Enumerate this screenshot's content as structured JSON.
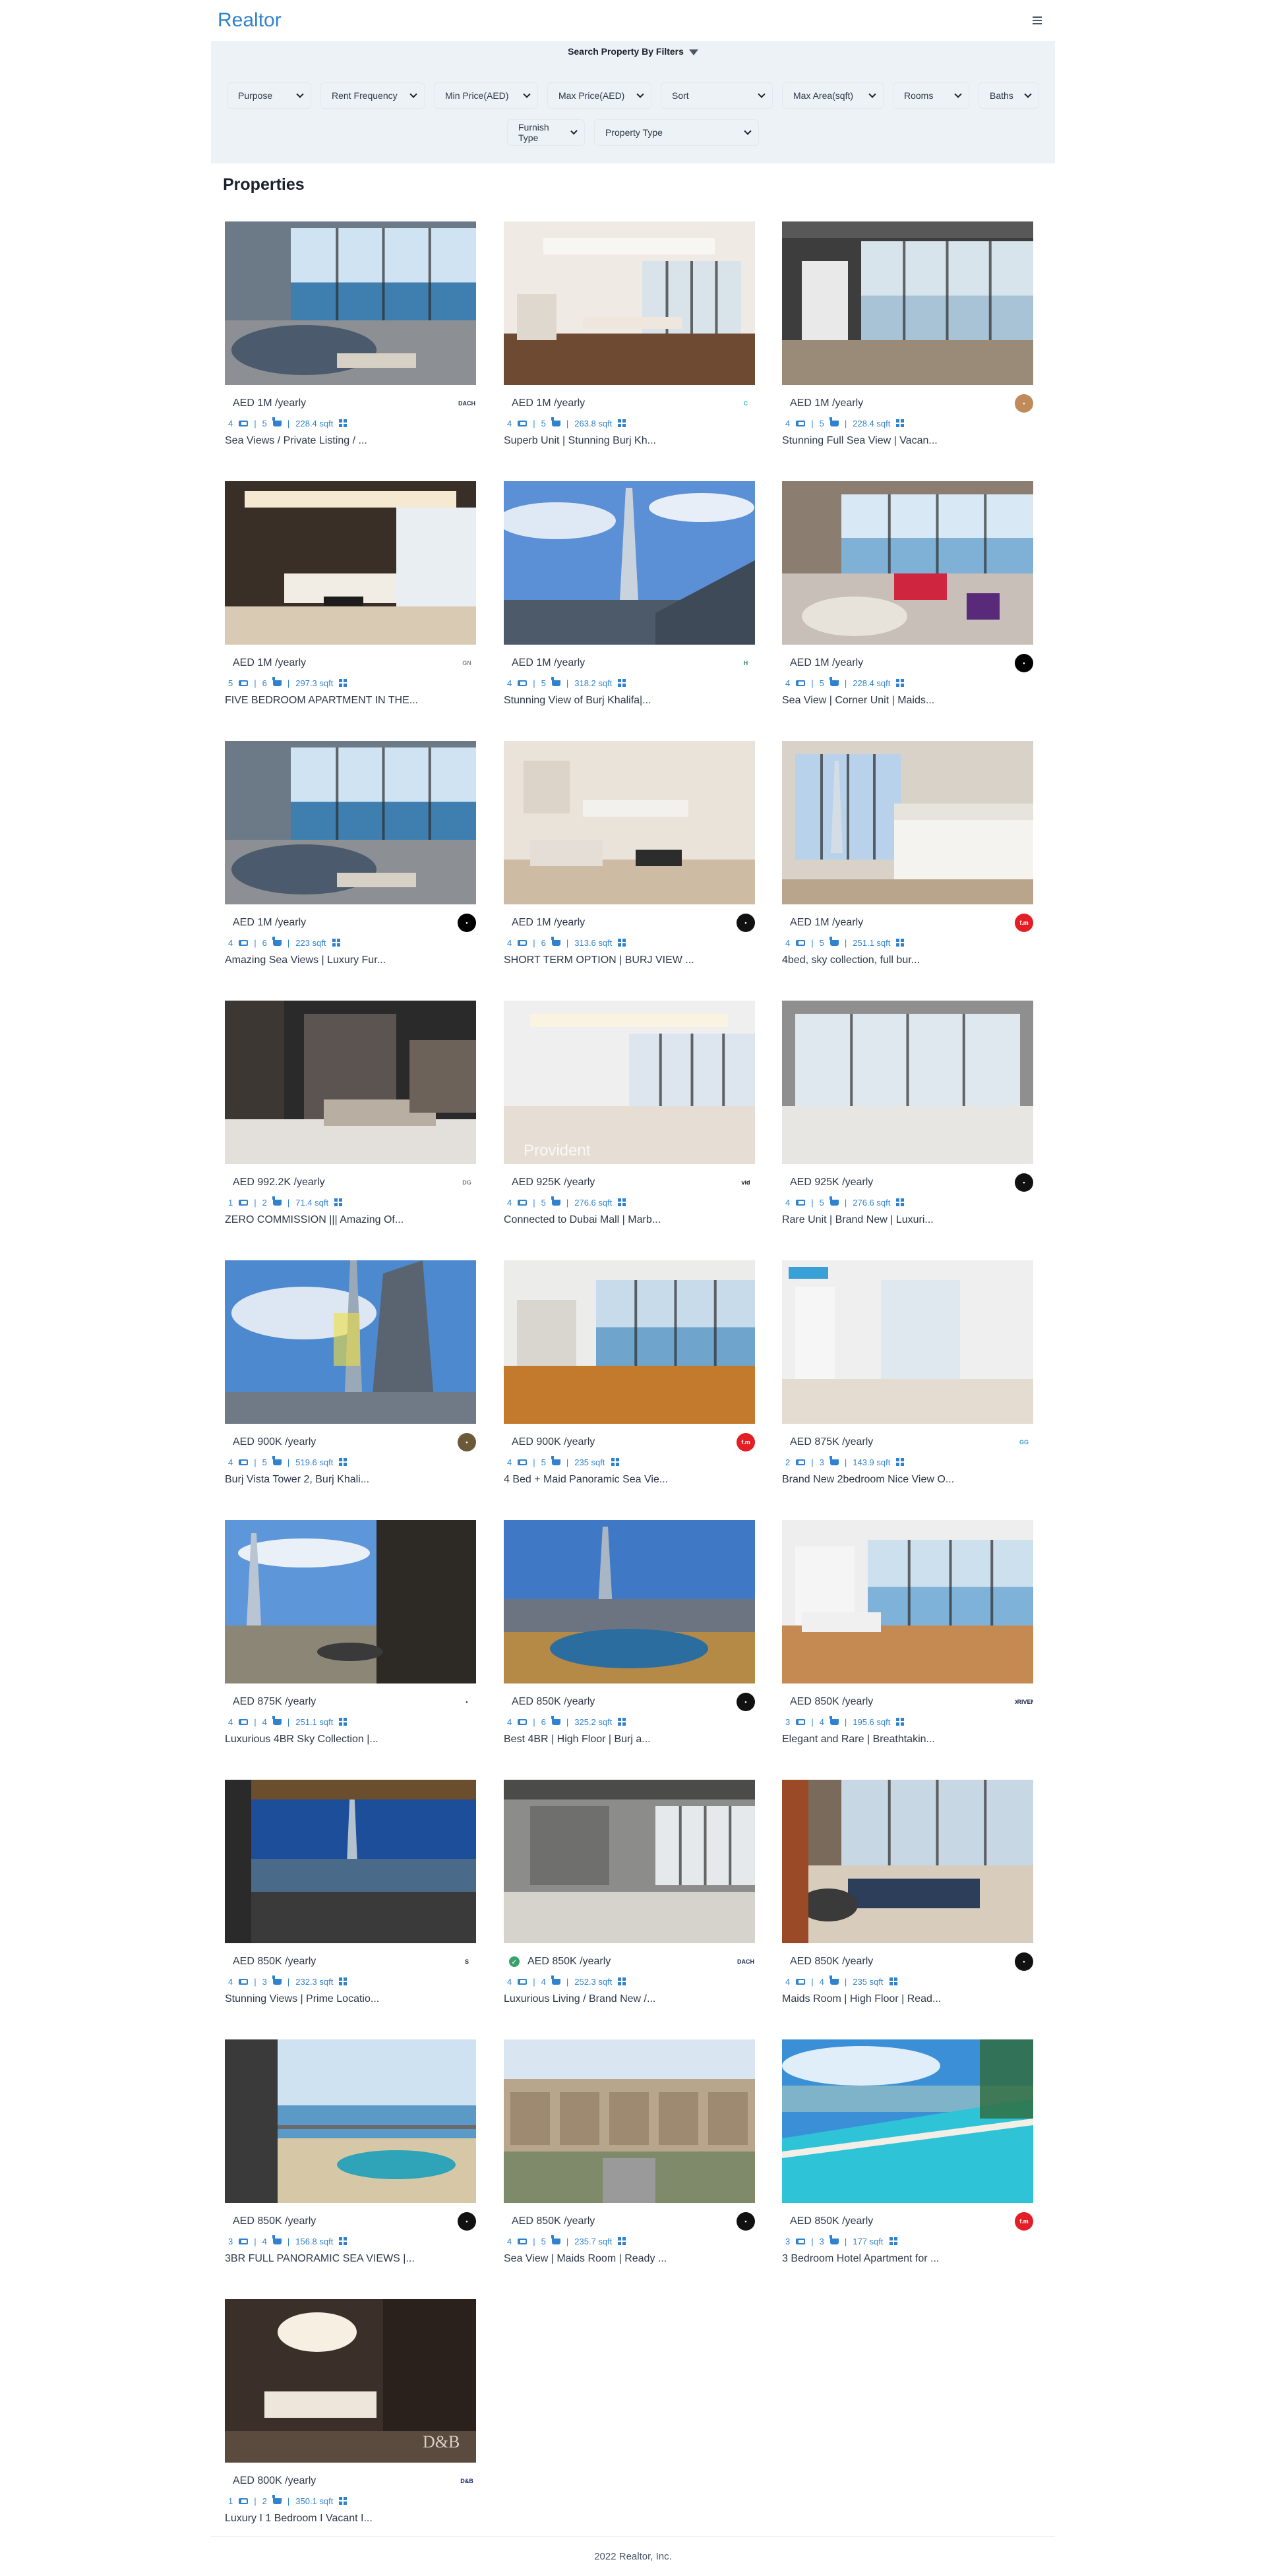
{
  "header": {
    "brand": "Realtor",
    "menu_icon": "hamburger-icon"
  },
  "filters": {
    "title": "Search Property By Filters",
    "row1": [
      {
        "label": "Purpose"
      },
      {
        "label": "Rent Frequency"
      },
      {
        "label": "Min Price(AED)"
      },
      {
        "label": "Max Price(AED)"
      },
      {
        "label": "Sort"
      },
      {
        "label": "Max Area(sqft)"
      },
      {
        "label": "Rooms"
      },
      {
        "label": "Baths"
      }
    ],
    "row2": [
      {
        "label": "Furnish Type"
      },
      {
        "label": "Property Type"
      }
    ]
  },
  "section": {
    "title": "Properties"
  },
  "listings": [
    {
      "price": "AED 1M /yearly",
      "verified": false,
      "rooms": "4",
      "baths": "5",
      "area": "228.4 sqft",
      "title": "Sea Views / Private Listing / ...",
      "agency": "DACH",
      "agency_color": "#ffffff",
      "agency_text_color": "#1a2a4a",
      "photo": "sea-living"
    },
    {
      "price": "AED 1M /yearly",
      "verified": false,
      "rooms": "4",
      "baths": "5",
      "area": "263.8 sqft",
      "title": "Superb Unit | Stunning Burj Kh...",
      "agency": "C",
      "agency_color": "#ffffff",
      "agency_text_color": "#3bb5c8",
      "photo": "dining"
    },
    {
      "price": "AED 1M /yearly",
      "verified": false,
      "rooms": "4",
      "baths": "5",
      "area": "228.4 sqft",
      "title": "Stunning Full Sea View | Vacan...",
      "agency": "•",
      "agency_color": "#c08a5a",
      "agency_text_color": "#ffffff",
      "photo": "empty-sea"
    },
    {
      "price": "AED 1M /yearly",
      "verified": false,
      "rooms": "5",
      "baths": "6",
      "area": "297.3 sqft",
      "title": "FIVE BEDROOM APARTMENT IN THE...",
      "agency": "GN",
      "agency_color": "#ffffff",
      "agency_text_color": "#888888",
      "photo": "lounge-warm"
    },
    {
      "price": "AED 1M /yearly",
      "verified": false,
      "rooms": "4",
      "baths": "5",
      "area": "318.2 sqft",
      "title": "Stunning View of Burj Khalifa|...",
      "agency": "H",
      "agency_color": "#ffffff",
      "agency_text_color": "#2e8b57",
      "photo": "burj-sky"
    },
    {
      "price": "AED 1M /yearly",
      "verified": false,
      "rooms": "4",
      "baths": "5",
      "area": "228.4 sqft",
      "title": "Sea View | Corner Unit | Maids...",
      "agency": "•",
      "agency_color": "#000000",
      "agency_text_color": "#ffffff",
      "photo": "colorful-room"
    },
    {
      "price": "AED 1M /yearly",
      "verified": false,
      "rooms": "4",
      "baths": "6",
      "area": "223 sqft",
      "title": "Amazing Sea Views | Luxury Fur...",
      "agency": "•",
      "agency_color": "#000000",
      "agency_text_color": "#ffffff",
      "photo": "sea-living"
    },
    {
      "price": "AED 1M /yearly",
      "verified": false,
      "rooms": "4",
      "baths": "6",
      "area": "313.6 sqft",
      "title": "SHORT TERM OPTION | BURJ VIEW ...",
      "agency": "•",
      "agency_color": "#111111",
      "agency_text_color": "#ffffff",
      "photo": "beige-lounge"
    },
    {
      "price": "AED 1M /yearly",
      "verified": false,
      "rooms": "4",
      "baths": "5",
      "area": "251.1 sqft",
      "title": "4bed, sky collection, full bur...",
      "agency": "f.m",
      "agency_color": "#e31e24",
      "agency_text_color": "#ffffff",
      "photo": "bedroom"
    },
    {
      "price": "AED 992.2K /yearly",
      "verified": false,
      "rooms": "1",
      "baths": "2",
      "area": "71.4 sqft",
      "title": "ZERO COMMISSION ||| Amazing Of...",
      "agency": "DG",
      "agency_color": "#ffffff",
      "agency_text_color": "#777777",
      "photo": "marble-hall"
    },
    {
      "price": "AED 925K /yearly",
      "verified": false,
      "rooms": "4",
      "baths": "5",
      "area": "276.6 sqft",
      "title": "Connected to Dubai Mall | Marb...",
      "agency": "vid",
      "agency_color": "#ffffff",
      "agency_text_color": "#111111",
      "photo": "empty-marble"
    },
    {
      "price": "AED 925K /yearly",
      "verified": false,
      "rooms": "4",
      "baths": "5",
      "area": "276.6 sqft",
      "title": "Rare Unit | Brand New | Luxuri...",
      "agency": "•",
      "agency_color": "#111111",
      "agency_text_color": "#ffffff",
      "photo": "empty-window"
    },
    {
      "price": "AED 900K /yearly",
      "verified": false,
      "rooms": "4",
      "baths": "5",
      "area": "519.6 sqft",
      "title": "Burj Vista Tower 2, Burj Khali...",
      "agency": "•",
      "agency_color": "#6b5a3a",
      "agency_text_color": "#ffffff",
      "photo": "tower-low"
    },
    {
      "price": "AED 900K /yearly",
      "verified": false,
      "rooms": "4",
      "baths": "5",
      "area": "235 sqft",
      "title": "4 Bed + Maid Panoramic Sea Vie...",
      "agency": "f.m",
      "agency_color": "#e31e24",
      "agency_text_color": "#ffffff",
      "photo": "wood-floor"
    },
    {
      "price": "AED 875K /yearly",
      "verified": false,
      "rooms": "2",
      "baths": "3",
      "area": "143.9 sqft",
      "title": "Brand New 2bedroom Nice View O...",
      "agency": "GG",
      "agency_color": "#ffffff",
      "agency_text_color": "#3aa0d8",
      "photo": "white-room"
    },
    {
      "price": "AED 875K /yearly",
      "verified": false,
      "rooms": "4",
      "baths": "4",
      "area": "251.1 sqft",
      "title": "Luxurious 4BR Sky Collection |...",
      "agency": "•",
      "agency_color": "#ffffff",
      "agency_text_color": "#333333",
      "photo": "balcony-burj"
    },
    {
      "price": "AED 850K /yearly",
      "verified": false,
      "rooms": "4",
      "baths": "6",
      "area": "325.2 sqft",
      "title": "Best 4BR | High Floor | Burj a...",
      "agency": "•",
      "agency_color": "#111111",
      "agency_text_color": "#ffffff",
      "photo": "city-top"
    },
    {
      "price": "AED 850K /yearly",
      "verified": false,
      "rooms": "3",
      "baths": "4",
      "area": "195.6 sqft",
      "title": "Elegant and Rare | Breathtakin...",
      "agency": "DRIVEN",
      "agency_color": "#ffffff",
      "agency_text_color": "#1a2a4a",
      "photo": "kitchen-view"
    },
    {
      "price": "AED 850K /yearly",
      "verified": false,
      "rooms": "4",
      "baths": "3",
      "area": "232.3 sqft",
      "title": "Stunning Views | Prime Locatio...",
      "agency": "S",
      "agency_color": "#ffffff",
      "agency_text_color": "#222222",
      "photo": "terrace-burj"
    },
    {
      "price": "AED 850K /yearly",
      "verified": true,
      "rooms": "4",
      "baths": "4",
      "area": "252.3 sqft",
      "title": "Luxurious Living / Brand New /...",
      "agency": "DACH",
      "agency_color": "#ffffff",
      "agency_text_color": "#1a2a4a",
      "photo": "grey-hall"
    },
    {
      "price": "AED 850K /yearly",
      "verified": false,
      "rooms": "4",
      "baths": "4",
      "area": "235 sqft",
      "title": "Maids Room | High Floor | Read...",
      "agency": "•",
      "agency_color": "#111111",
      "agency_text_color": "#ffffff",
      "photo": "navy-lounge"
    },
    {
      "price": "AED 850K /yearly",
      "verified": false,
      "rooms": "3",
      "baths": "4",
      "area": "156.8 sqft",
      "title": "3BR FULL PANORAMIC SEA VIEWS |...",
      "agency": "•",
      "agency_color": "#111111",
      "agency_text_color": "#ffffff",
      "photo": "beach-balcony"
    },
    {
      "price": "AED 850K /yearly",
      "verified": false,
      "rooms": "4",
      "baths": "5",
      "area": "235.7 sqft",
      "title": "Sea View | Maids Room | Ready ...",
      "agency": "•",
      "agency_color": "#111111",
      "agency_text_color": "#ffffff",
      "photo": "townhouses"
    },
    {
      "price": "AED 850K /yearly",
      "verified": false,
      "rooms": "3",
      "baths": "3",
      "area": "177 sqft",
      "title": "3 Bedroom Hotel Apartment for ...",
      "agency": "f.m",
      "agency_color": "#e31e24",
      "agency_text_color": "#ffffff",
      "photo": "pool"
    },
    {
      "price": "AED 800K /yearly",
      "verified": false,
      "rooms": "1",
      "baths": "2",
      "area": "350.1 sqft",
      "title": "Luxury I 1 Bedroom I Vacant I...",
      "agency": "D&B",
      "agency_color": "#ffffff",
      "agency_text_color": "#1a2a6a",
      "photo": "dark-dining"
    }
  ],
  "footer": {
    "text": "2022 Realtor, Inc."
  }
}
